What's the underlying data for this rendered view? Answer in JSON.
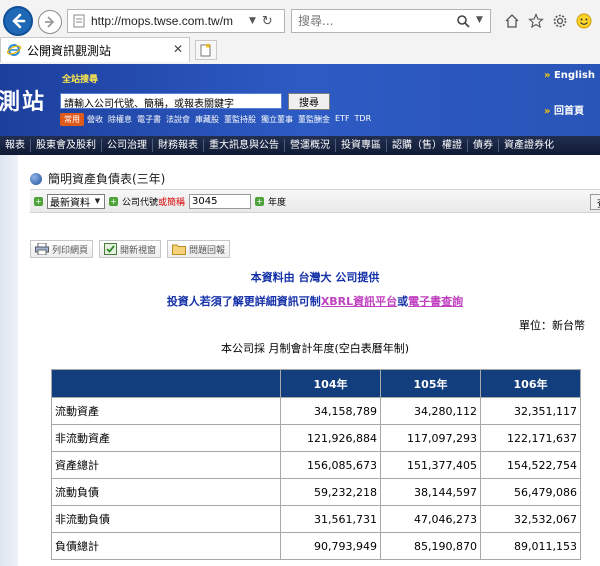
{
  "browser": {
    "url": "http://mops.twse.com.tw/m",
    "search_placeholder": "搜尋...",
    "tab_title": "公開資訊觀測站"
  },
  "banner": {
    "logo": "測站",
    "site_search_label": "全站搜尋",
    "keyword_input_value": "請輸入公司代號、簡稱，或報表關鍵字",
    "search_button": "搜尋",
    "common_badge": "常用",
    "quick_links": [
      "營收",
      "除權息",
      "電子書",
      "法說會",
      "庫藏股",
      "董監持股",
      "獨立董事",
      "董監酬金",
      "ETF",
      "TDR"
    ],
    "lang_link": "English",
    "home_link": "回首頁"
  },
  "main_nav": [
    "報表",
    "股東會及股利",
    "公司治理",
    "財務報表",
    "重大訊息與公告",
    "營運概況",
    "投資專區",
    "認購（售）權證",
    "債券",
    "資產證券化"
  ],
  "section": {
    "title": "簡明資產負債表(三年)"
  },
  "filter": {
    "data_select": "最新資料",
    "code_label": "公司代號",
    "code_label_or": "或",
    "code_label_short": "簡稱",
    "code_value": "3045",
    "year_label": "年度",
    "query_button": "查詢"
  },
  "actions": {
    "print": "列印網頁",
    "new_window": "開新視窗",
    "feedback": "問題回報"
  },
  "provider_text": "本資料由 台灣大 公司提供",
  "xbrl": {
    "prefix": "投資人若須了解更詳細資訊可制",
    "link1": "XBRL資訊平台",
    "or": "或",
    "link2": "電子書查詢"
  },
  "unit_text": "單位：新台幣",
  "basis_text": "本公司採  月制會計年度(空白表曆年制)",
  "table": {
    "headers": [
      "",
      "104年",
      "105年",
      "106年"
    ],
    "rows": [
      {
        "label": "流動資產",
        "values": [
          "34,158,789",
          "34,280,112",
          "32,351,117"
        ]
      },
      {
        "label": "非流動資產",
        "values": [
          "121,926,884",
          "117,097,293",
          "122,171,637"
        ]
      },
      {
        "label": "資產總計",
        "values": [
          "156,085,673",
          "151,377,405",
          "154,522,754"
        ]
      },
      {
        "label": "流動負債",
        "values": [
          "59,232,218",
          "38,144,597",
          "56,479,086"
        ]
      },
      {
        "label": "非流動負債",
        "values": [
          "31,561,731",
          "47,046,273",
          "32,532,067"
        ]
      },
      {
        "label": "負債總計",
        "values": [
          "90,793,949",
          "85,190,870",
          "89,011,153"
        ]
      }
    ]
  },
  "colors": {
    "banner_blue": "#2d5bc4",
    "nav_dark": "#0f1a33",
    "table_header": "#133e7d",
    "link_blue": "#1531a8",
    "link_magenta": "#c040c0"
  }
}
